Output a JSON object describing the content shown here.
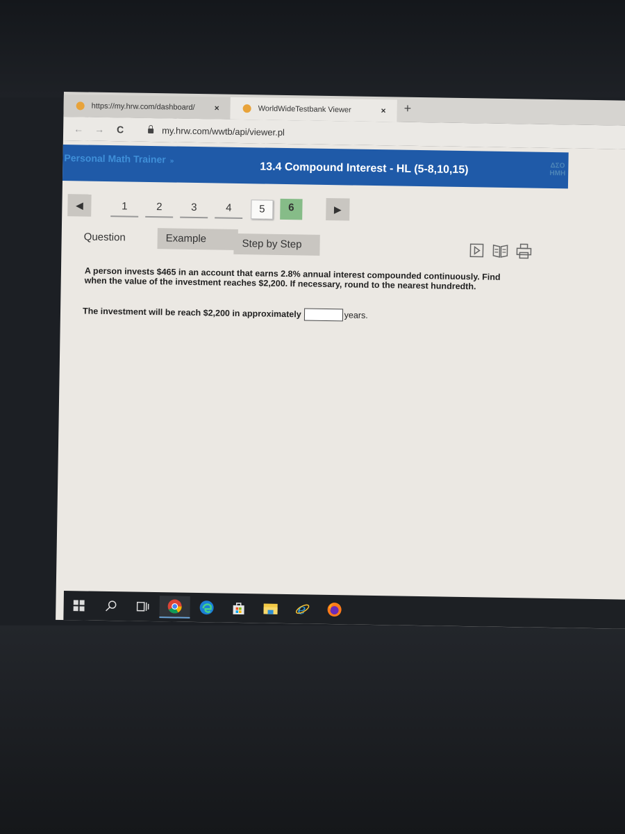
{
  "browser": {
    "tabs": [
      {
        "title": "https://my.hrw.com/dashboard/",
        "close": "×",
        "active": false
      },
      {
        "title": "WorldWideTestbank Viewer",
        "close": "×",
        "active": true
      }
    ],
    "new_tab": "+",
    "nav": {
      "back": "←",
      "forward": "→",
      "reload": "C"
    },
    "url": "my.hrw.com/wwtb/api/viewer.pl"
  },
  "banner": {
    "brand": "Personal Math Trainer",
    "brand_caret": "»",
    "title": "13.4 Compound Interest - HL (5-8,10,15)",
    "logo_line1": "ΔΣΟ",
    "logo_line2": "HMH",
    "color": "#1f5aa8"
  },
  "pager": {
    "prev": "◀",
    "next": "▶",
    "pages": [
      {
        "label": "1",
        "state": "done"
      },
      {
        "label": "2",
        "state": "done"
      },
      {
        "label": "3",
        "state": "done"
      },
      {
        "label": "4",
        "state": "done"
      },
      {
        "label": "5",
        "state": "current"
      },
      {
        "label": "6",
        "state": "active"
      }
    ],
    "active_color": "#86bc88"
  },
  "content_tabs": [
    {
      "label": "Question",
      "selected": true
    },
    {
      "label": "Example",
      "selected": false
    },
    {
      "label": "Step by Step",
      "selected": false
    }
  ],
  "tools": [
    "video-icon",
    "book-icon",
    "print-icon"
  ],
  "question": {
    "text": "A person invests $465 in an account that earns 2.8% annual interest compounded continuously. Find when the value of the investment reaches $2,200. If necessary, round to the nearest hundredth.",
    "answer_prefix": "The investment will be reach $2,200 in approximately",
    "answer_value": "",
    "answer_suffix": "years."
  },
  "taskbar": {
    "items": [
      "windows-start",
      "search",
      "task-view",
      "chrome",
      "edge",
      "store",
      "file-explorer",
      "internet-explorer",
      "firefox"
    ],
    "active": "chrome"
  }
}
